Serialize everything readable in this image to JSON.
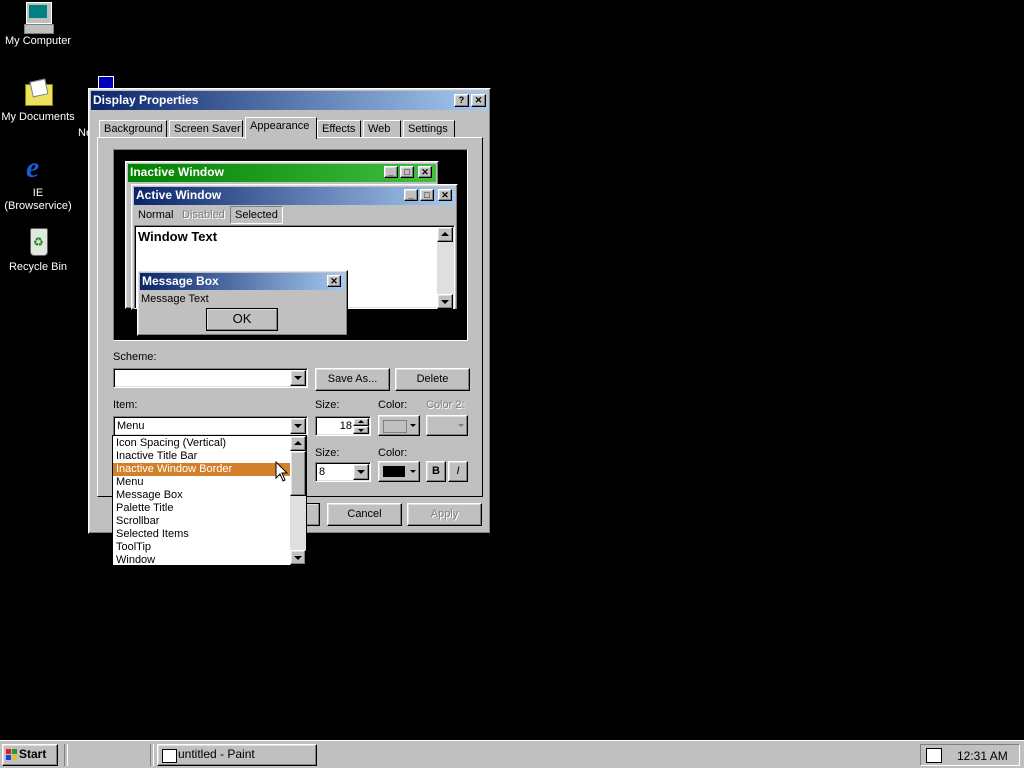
{
  "desktop": {
    "icons": [
      {
        "label": "My Computer"
      },
      {
        "label": "My Documents"
      },
      {
        "label": "IE\n(Browservice)"
      },
      {
        "label": "Recycle Bin"
      }
    ],
    "partial_label": "Ne"
  },
  "dialog": {
    "title": "Display Properties",
    "help_label": "?",
    "close_label": "✕",
    "tabs": [
      "Background",
      "Screen Saver",
      "Appearance",
      "Effects",
      "Web",
      "Settings"
    ],
    "preview": {
      "inactive_title": "Inactive Window",
      "active_title": "Active Window",
      "menu_items": [
        "Normal",
        "Disabled",
        "Selected"
      ],
      "window_text": "Window Text",
      "msgbox_title": "Message Box",
      "msgbox_text": "Message Text",
      "ok_label": "OK"
    },
    "scheme_label": "Scheme:",
    "scheme_value": "",
    "save_as_label": "Save As...",
    "delete_label": "Delete",
    "item_label": "Item:",
    "item_value": "Menu",
    "size_label": "Size:",
    "size_value": "18",
    "color_label": "Color:",
    "color2_label": "Color 2:",
    "font_size_label": "Size:",
    "font_size_value": "8",
    "font_color_label": "Color:",
    "bold_label": "B",
    "italic_label": "I",
    "item_list": [
      "Icon Spacing (Vertical)",
      "Inactive Title Bar",
      "Inactive Window Border",
      "Menu",
      "Message Box",
      "Palette Title",
      "Scrollbar",
      "Selected Items",
      "ToolTip",
      "Window"
    ],
    "highlighted_index": 2,
    "cancel_label": "Cancel",
    "apply_label": "Apply"
  },
  "taskbar": {
    "start_label": "Start",
    "task_label": "untitled - Paint",
    "clock": "12:31 AM"
  },
  "colors": {
    "active_title_start": "#0a246a",
    "active_title_end": "#a6caf0",
    "inactive_title_start": "#008000",
    "inactive_title_end": "#40c040",
    "highlight": "#d4802a"
  }
}
